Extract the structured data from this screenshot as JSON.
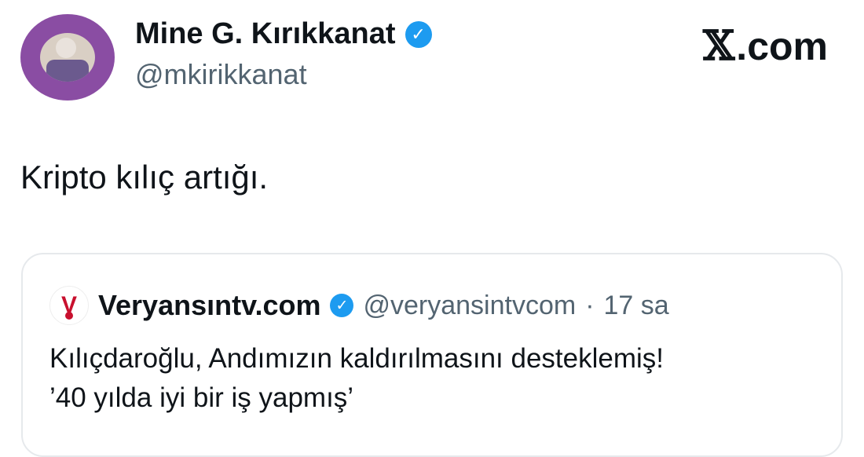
{
  "author": {
    "name": "Mine G. Kırıkkanat",
    "handle": "@mkirikkanat",
    "verified_icon": "check-badge-icon"
  },
  "brand": {
    "x_mark": "𝕏",
    "domain": ".com"
  },
  "tweet": {
    "text": "Kripto kılıç artığı."
  },
  "quoted_tweet": {
    "name": "Veryansıntv.com",
    "handle": "@veryansintvcom",
    "separator": "·",
    "time": "17 sa",
    "line1": "Kılıçdaroğlu, Andımızın kaldırılmasını desteklemiş!",
    "line2": "’40 yılda iyi bir iş yapmış’"
  },
  "colors": {
    "verified_blue": "#1d9bf0",
    "handle_gray": "#536471",
    "avatar_purple": "#8a4da3",
    "quote_logo_red": "#c8102e"
  }
}
